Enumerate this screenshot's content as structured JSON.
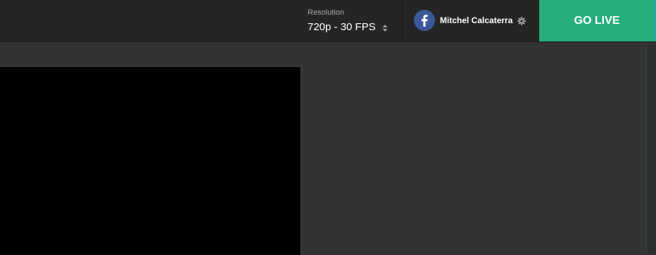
{
  "header": {
    "resolution": {
      "label": "Resolution",
      "value": "720p - 30 FPS",
      "icon": "sort-arrows-icon"
    },
    "account": {
      "platform_icon": "facebook-icon",
      "name": "Mitchel Calcaterra",
      "settings_icon": "gear-icon"
    },
    "go_live_label": "GO LIVE"
  },
  "colors": {
    "topbar_bg": "#252525",
    "workspace_bg": "#333333",
    "facebook_blue": "#3b5998",
    "go_live_green": "#26ae7d",
    "preview_bg": "#000000"
  }
}
